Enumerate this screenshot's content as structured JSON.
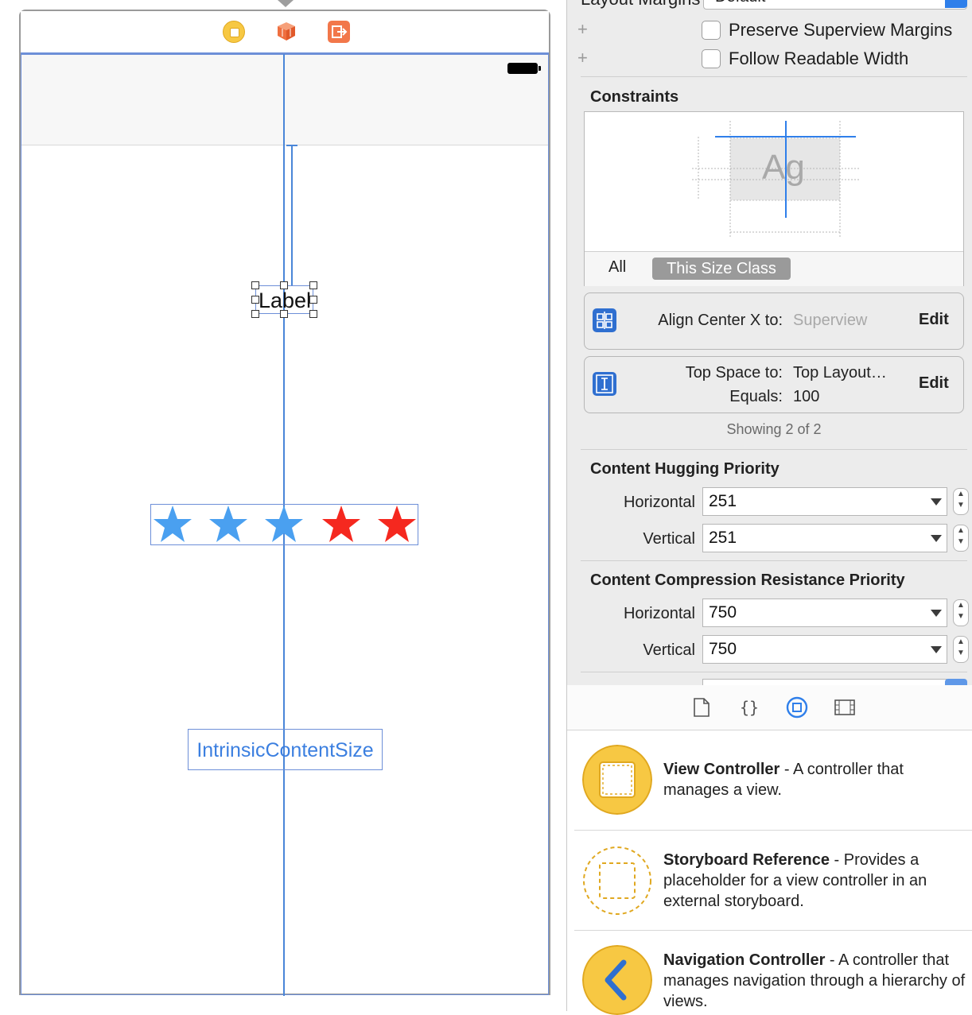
{
  "canvas": {
    "label_text": "Label",
    "intrinsic_button_text": "IntrinsicContentSize",
    "stars": [
      {
        "color": "#4aa0f0"
      },
      {
        "color": "#4aa0f0"
      },
      {
        "color": "#4aa0f0"
      },
      {
        "color": "#f5281f"
      },
      {
        "color": "#f5281f"
      }
    ],
    "guide_color": "#4a86d8"
  },
  "inspector": {
    "layout_margins_label": "Layout Margins",
    "layout_margins_value": "Default",
    "preserve_superview_margins": "Preserve Superview Margins",
    "follow_readable_width": "Follow Readable Width",
    "constraints_title": "Constraints",
    "preview_glyph": "Ag",
    "size_class_all": "All",
    "size_class_this": "This Size Class",
    "constraint_cards": [
      {
        "label": "Align Center X to:",
        "value": "Superview",
        "edit": "Edit"
      },
      {
        "label_1": "Top Space to:",
        "value_1": "Top Layout…",
        "label_2": "Equals:",
        "value_2": "100",
        "edit": "Edit"
      }
    ],
    "showing": "Showing 2 of 2",
    "hugging_title": "Content Hugging Priority",
    "hugging": {
      "horizontal_label": "Horizontal",
      "horizontal": "251",
      "vertical_label": "Vertical",
      "vertical": "251"
    },
    "compression_title": "Content Compression Resistance Priority",
    "compression": {
      "horizontal_label": "Horizontal",
      "horizontal": "750",
      "vertical_label": "Vertical",
      "vertical": "750"
    }
  },
  "library": {
    "tabs": [
      "file-template-icon",
      "code-snippet-icon",
      "object-library-icon",
      "media-library-icon"
    ],
    "items": [
      {
        "title": "View Controller",
        "desc": " - A controller that manages a view."
      },
      {
        "title": "Storyboard Reference",
        "desc": " - Provides a placeholder for a view controller in an external storyboard."
      },
      {
        "title": "Navigation Controller",
        "desc": " - A controller that manages navigation through a hierarchy of views."
      }
    ]
  }
}
